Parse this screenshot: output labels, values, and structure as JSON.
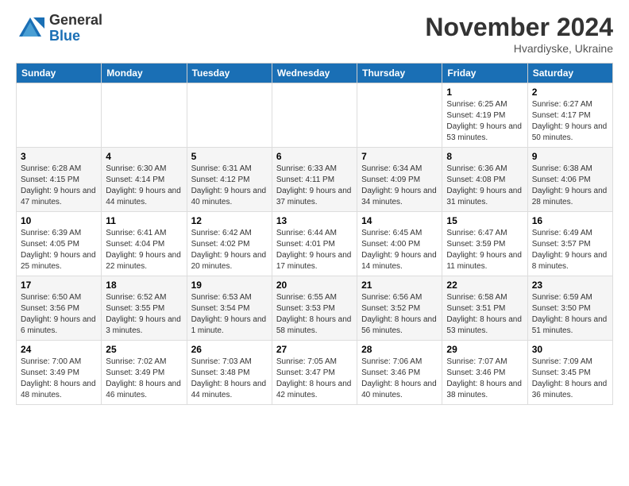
{
  "logo": {
    "general": "General",
    "blue": "Blue"
  },
  "title": "November 2024",
  "subtitle": "Hvardiyske, Ukraine",
  "days_of_week": [
    "Sunday",
    "Monday",
    "Tuesday",
    "Wednesday",
    "Thursday",
    "Friday",
    "Saturday"
  ],
  "weeks": [
    [
      {
        "day": "",
        "info": ""
      },
      {
        "day": "",
        "info": ""
      },
      {
        "day": "",
        "info": ""
      },
      {
        "day": "",
        "info": ""
      },
      {
        "day": "",
        "info": ""
      },
      {
        "day": "1",
        "info": "Sunrise: 6:25 AM\nSunset: 4:19 PM\nDaylight: 9 hours and 53 minutes."
      },
      {
        "day": "2",
        "info": "Sunrise: 6:27 AM\nSunset: 4:17 PM\nDaylight: 9 hours and 50 minutes."
      }
    ],
    [
      {
        "day": "3",
        "info": "Sunrise: 6:28 AM\nSunset: 4:15 PM\nDaylight: 9 hours and 47 minutes."
      },
      {
        "day": "4",
        "info": "Sunrise: 6:30 AM\nSunset: 4:14 PM\nDaylight: 9 hours and 44 minutes."
      },
      {
        "day": "5",
        "info": "Sunrise: 6:31 AM\nSunset: 4:12 PM\nDaylight: 9 hours and 40 minutes."
      },
      {
        "day": "6",
        "info": "Sunrise: 6:33 AM\nSunset: 4:11 PM\nDaylight: 9 hours and 37 minutes."
      },
      {
        "day": "7",
        "info": "Sunrise: 6:34 AM\nSunset: 4:09 PM\nDaylight: 9 hours and 34 minutes."
      },
      {
        "day": "8",
        "info": "Sunrise: 6:36 AM\nSunset: 4:08 PM\nDaylight: 9 hours and 31 minutes."
      },
      {
        "day": "9",
        "info": "Sunrise: 6:38 AM\nSunset: 4:06 PM\nDaylight: 9 hours and 28 minutes."
      }
    ],
    [
      {
        "day": "10",
        "info": "Sunrise: 6:39 AM\nSunset: 4:05 PM\nDaylight: 9 hours and 25 minutes."
      },
      {
        "day": "11",
        "info": "Sunrise: 6:41 AM\nSunset: 4:04 PM\nDaylight: 9 hours and 22 minutes."
      },
      {
        "day": "12",
        "info": "Sunrise: 6:42 AM\nSunset: 4:02 PM\nDaylight: 9 hours and 20 minutes."
      },
      {
        "day": "13",
        "info": "Sunrise: 6:44 AM\nSunset: 4:01 PM\nDaylight: 9 hours and 17 minutes."
      },
      {
        "day": "14",
        "info": "Sunrise: 6:45 AM\nSunset: 4:00 PM\nDaylight: 9 hours and 14 minutes."
      },
      {
        "day": "15",
        "info": "Sunrise: 6:47 AM\nSunset: 3:59 PM\nDaylight: 9 hours and 11 minutes."
      },
      {
        "day": "16",
        "info": "Sunrise: 6:49 AM\nSunset: 3:57 PM\nDaylight: 9 hours and 8 minutes."
      }
    ],
    [
      {
        "day": "17",
        "info": "Sunrise: 6:50 AM\nSunset: 3:56 PM\nDaylight: 9 hours and 6 minutes."
      },
      {
        "day": "18",
        "info": "Sunrise: 6:52 AM\nSunset: 3:55 PM\nDaylight: 9 hours and 3 minutes."
      },
      {
        "day": "19",
        "info": "Sunrise: 6:53 AM\nSunset: 3:54 PM\nDaylight: 9 hours and 1 minute."
      },
      {
        "day": "20",
        "info": "Sunrise: 6:55 AM\nSunset: 3:53 PM\nDaylight: 8 hours and 58 minutes."
      },
      {
        "day": "21",
        "info": "Sunrise: 6:56 AM\nSunset: 3:52 PM\nDaylight: 8 hours and 56 minutes."
      },
      {
        "day": "22",
        "info": "Sunrise: 6:58 AM\nSunset: 3:51 PM\nDaylight: 8 hours and 53 minutes."
      },
      {
        "day": "23",
        "info": "Sunrise: 6:59 AM\nSunset: 3:50 PM\nDaylight: 8 hours and 51 minutes."
      }
    ],
    [
      {
        "day": "24",
        "info": "Sunrise: 7:00 AM\nSunset: 3:49 PM\nDaylight: 8 hours and 48 minutes."
      },
      {
        "day": "25",
        "info": "Sunrise: 7:02 AM\nSunset: 3:49 PM\nDaylight: 8 hours and 46 minutes."
      },
      {
        "day": "26",
        "info": "Sunrise: 7:03 AM\nSunset: 3:48 PM\nDaylight: 8 hours and 44 minutes."
      },
      {
        "day": "27",
        "info": "Sunrise: 7:05 AM\nSunset: 3:47 PM\nDaylight: 8 hours and 42 minutes."
      },
      {
        "day": "28",
        "info": "Sunrise: 7:06 AM\nSunset: 3:46 PM\nDaylight: 8 hours and 40 minutes."
      },
      {
        "day": "29",
        "info": "Sunrise: 7:07 AM\nSunset: 3:46 PM\nDaylight: 8 hours and 38 minutes."
      },
      {
        "day": "30",
        "info": "Sunrise: 7:09 AM\nSunset: 3:45 PM\nDaylight: 8 hours and 36 minutes."
      }
    ]
  ]
}
